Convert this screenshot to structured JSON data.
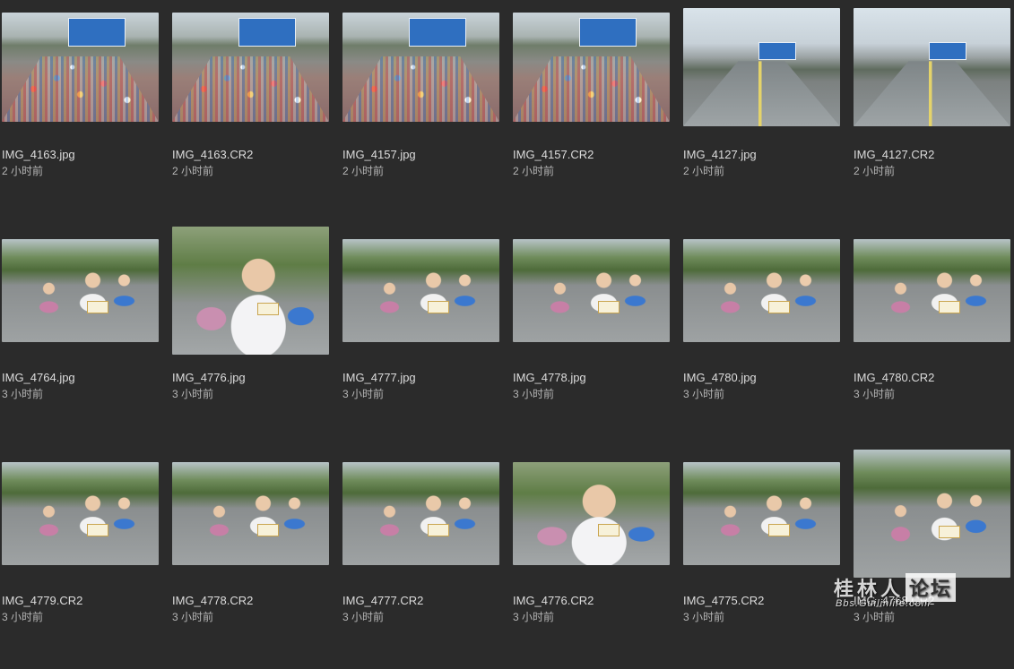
{
  "files": [
    {
      "name": "IMG_4163.jpg",
      "time": "2 小时前",
      "kind": "crowd"
    },
    {
      "name": "IMG_4163.CR2",
      "time": "2 小时前",
      "kind": "crowd"
    },
    {
      "name": "IMG_4157.jpg",
      "time": "2 小时前",
      "kind": "crowd"
    },
    {
      "name": "IMG_4157.CR2",
      "time": "2 小时前",
      "kind": "crowd"
    },
    {
      "name": "IMG_4127.jpg",
      "time": "2 小时前",
      "kind": "street"
    },
    {
      "name": "IMG_4127.CR2",
      "time": "2 小时前",
      "kind": "street"
    },
    {
      "name": "IMG_4764.jpg",
      "time": "3 小时前",
      "kind": "runners"
    },
    {
      "name": "IMG_4776.jpg",
      "time": "3 小时前",
      "kind": "runners tall closeup"
    },
    {
      "name": "IMG_4777.jpg",
      "time": "3 小时前",
      "kind": "runners"
    },
    {
      "name": "IMG_4778.jpg",
      "time": "3 小时前",
      "kind": "runners"
    },
    {
      "name": "IMG_4780.jpg",
      "time": "3 小时前",
      "kind": "runners"
    },
    {
      "name": "IMG_4780.CR2",
      "time": "3 小时前",
      "kind": "runners"
    },
    {
      "name": "IMG_4779.CR2",
      "time": "3 小时前",
      "kind": "runners"
    },
    {
      "name": "IMG_4778.CR2",
      "time": "3 小时前",
      "kind": "runners"
    },
    {
      "name": "IMG_4777.CR2",
      "time": "3 小时前",
      "kind": "runners"
    },
    {
      "name": "IMG_4776.CR2",
      "time": "3 小时前",
      "kind": "runners closeup"
    },
    {
      "name": "IMG_4775.CR2",
      "time": "3 小时前",
      "kind": "runners"
    },
    {
      "name": "IMG_4768.CR2",
      "time": "3 小时前",
      "kind": "runners tall"
    }
  ],
  "watermark": {
    "main": "桂林人",
    "boxed": "论坛",
    "sub": "Bbs.Guilinlife.com"
  },
  "colors": {
    "background": "#2b2b2b",
    "filename": "#dcdcdc",
    "meta": "#b5b5b5"
  }
}
